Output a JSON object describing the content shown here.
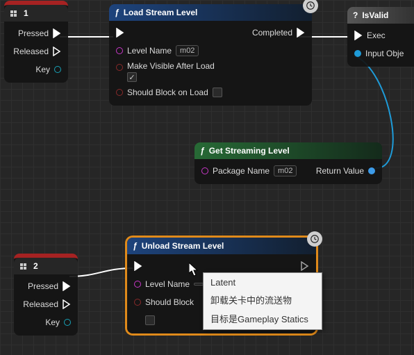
{
  "input1": {
    "title": "1",
    "pressed": "Pressed",
    "released": "Released",
    "key": "Key"
  },
  "load": {
    "title": "Load Stream Level",
    "completed": "Completed",
    "level_name": "Level Name",
    "level_name_value": "m02",
    "make_visible": "Make Visible After Load",
    "make_visible_checked": "✓",
    "block": "Should Block on Load"
  },
  "isvalid": {
    "title": "IsValid",
    "exec": "Exec",
    "input_obj": "Input Obje"
  },
  "getstream": {
    "title": "Get Streaming Level",
    "package_name": "Package Name",
    "package_value": "m02",
    "return": "Return Value"
  },
  "input2": {
    "title": "2",
    "pressed": "Pressed",
    "released": "Released",
    "key": "Key"
  },
  "unload": {
    "title": "Unload Stream Level",
    "level_name": "Level Name",
    "block": "Should Block"
  },
  "tooltip": {
    "title": "Latent",
    "line1": "卸载关卡中的流送物",
    "line2": "目标是Gameplay Statics"
  }
}
